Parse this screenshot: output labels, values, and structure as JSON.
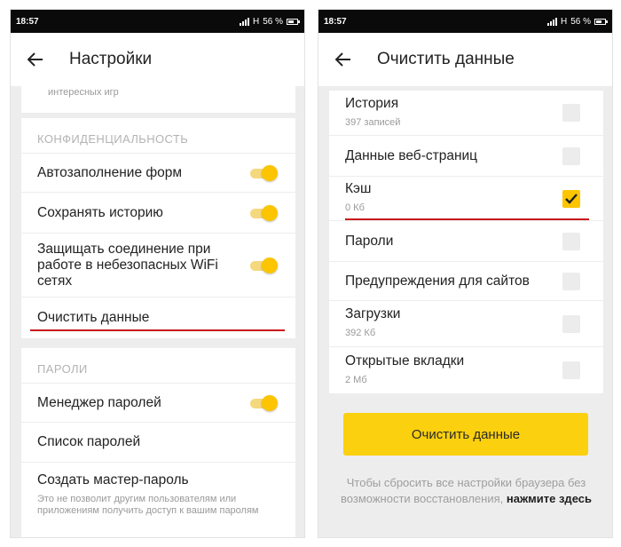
{
  "left": {
    "status": {
      "time": "18:57",
      "network": "H",
      "battery": "56 %"
    },
    "title": "Настройки",
    "top_fragment": "интересных игр",
    "privacy": {
      "header": "КОНФИДЕНЦИАЛЬНОСТЬ",
      "autofill": {
        "label": "Автозаполнение форм",
        "enabled": true
      },
      "save_history": {
        "label": "Сохранять историю",
        "enabled": true
      },
      "protect_wifi": {
        "label": "Защищать соединение при работе в небезопасных WiFi сетях",
        "enabled": true
      },
      "clear_data": "Очистить данные"
    },
    "passwords": {
      "header": "ПАРОЛИ",
      "manager": {
        "label": "Менеджер паролей",
        "enabled": true
      },
      "list": "Список паролей",
      "master": "Создать мастер-пароль",
      "master_note": "Это не позволит другим пользователям или приложениям получить доступ к вашим паролям"
    }
  },
  "right": {
    "status": {
      "time": "18:57",
      "network": "H",
      "battery": "56 %"
    },
    "title": "Очистить данные",
    "items": [
      {
        "label": "История",
        "sub": "397 записей",
        "checked": false
      },
      {
        "label": "Данные веб-страниц",
        "sub": "",
        "checked": false
      },
      {
        "label": "Кэш",
        "sub": "0 Кб",
        "checked": true
      },
      {
        "label": "Пароли",
        "sub": "",
        "checked": false
      },
      {
        "label": "Предупреждения для сайтов",
        "sub": "",
        "checked": false
      },
      {
        "label": "Загрузки",
        "sub": "392 Кб",
        "checked": false
      },
      {
        "label": "Открытые вкладки",
        "sub": "2 Мб",
        "checked": false
      }
    ],
    "clear_button": "Очистить данные",
    "reset_note": "Чтобы сбросить все настройки браузера без возможности восстановления,",
    "reset_link": "нажмите здесь"
  },
  "colors": {
    "accent": "#fcc500",
    "toggle_track": "#f5d77e",
    "underline": "#c9191b",
    "background": "#ededed"
  },
  "icons": [
    "arrow-back",
    "signal",
    "battery",
    "checkmark",
    "toggle"
  ]
}
